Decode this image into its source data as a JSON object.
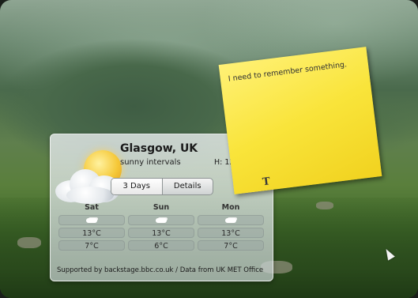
{
  "weather": {
    "city": "Glasgow, UK",
    "condition": "sunny intervals",
    "high": "H: 13°C",
    "tabs": [
      "3 Days",
      "Details"
    ],
    "days": [
      {
        "name": "Sat",
        "high": "13°C",
        "low": "7°C",
        "icon": "cloud-icon"
      },
      {
        "name": "Sun",
        "high": "13°C",
        "low": "6°C",
        "icon": "cloud-icon"
      },
      {
        "name": "Mon",
        "high": "13°C",
        "low": "7°C",
        "icon": "cloud-icon"
      }
    ],
    "footer": "Supported by backstage.bbc.co.uk / Data from UK MET Office"
  },
  "note": {
    "text": "I need to remember something.",
    "icon_glyph": "T"
  },
  "colors": {
    "note": "#f9e43a",
    "widget": "#dfe5e5"
  }
}
